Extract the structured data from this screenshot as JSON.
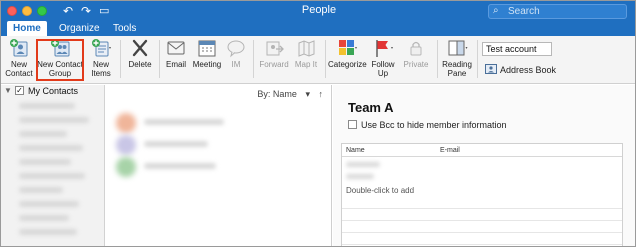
{
  "window": {
    "title": "People"
  },
  "search": {
    "placeholder": "Search"
  },
  "tabs": [
    {
      "label": "Home",
      "active": true
    },
    {
      "label": "Organize",
      "active": false
    },
    {
      "label": "Tools",
      "active": false
    }
  ],
  "ribbon": {
    "new_contact": "New Contact",
    "new_contact_line1": "New",
    "new_contact_line2": "Contact",
    "new_contact_group_line1": "New Contact",
    "new_contact_group_line2": "Group",
    "new_items_line1": "New",
    "new_items_line2": "Items",
    "delete": "Delete",
    "email": "Email",
    "meeting": "Meeting",
    "im": "IM",
    "forward": "Forward",
    "map_it": "Map It",
    "categorize": "Categorize",
    "follow_up_line1": "Follow",
    "follow_up_line2": "Up",
    "private": "Private",
    "reading_pane_line1": "Reading",
    "reading_pane_line2": "Pane",
    "account_value": "Test account",
    "address_book": "Address Book"
  },
  "sidebar": {
    "my_contacts": "My Contacts"
  },
  "list": {
    "sort_label": "By: Name"
  },
  "detail": {
    "group_name": "Team A",
    "bcc_label": "Use Bcc to hide member information",
    "col_name": "Name",
    "col_email": "E-mail",
    "add_hint": "Double-click to add"
  },
  "colors": {
    "accent": "#1f6fc0",
    "highlight": "#e23a1a"
  }
}
